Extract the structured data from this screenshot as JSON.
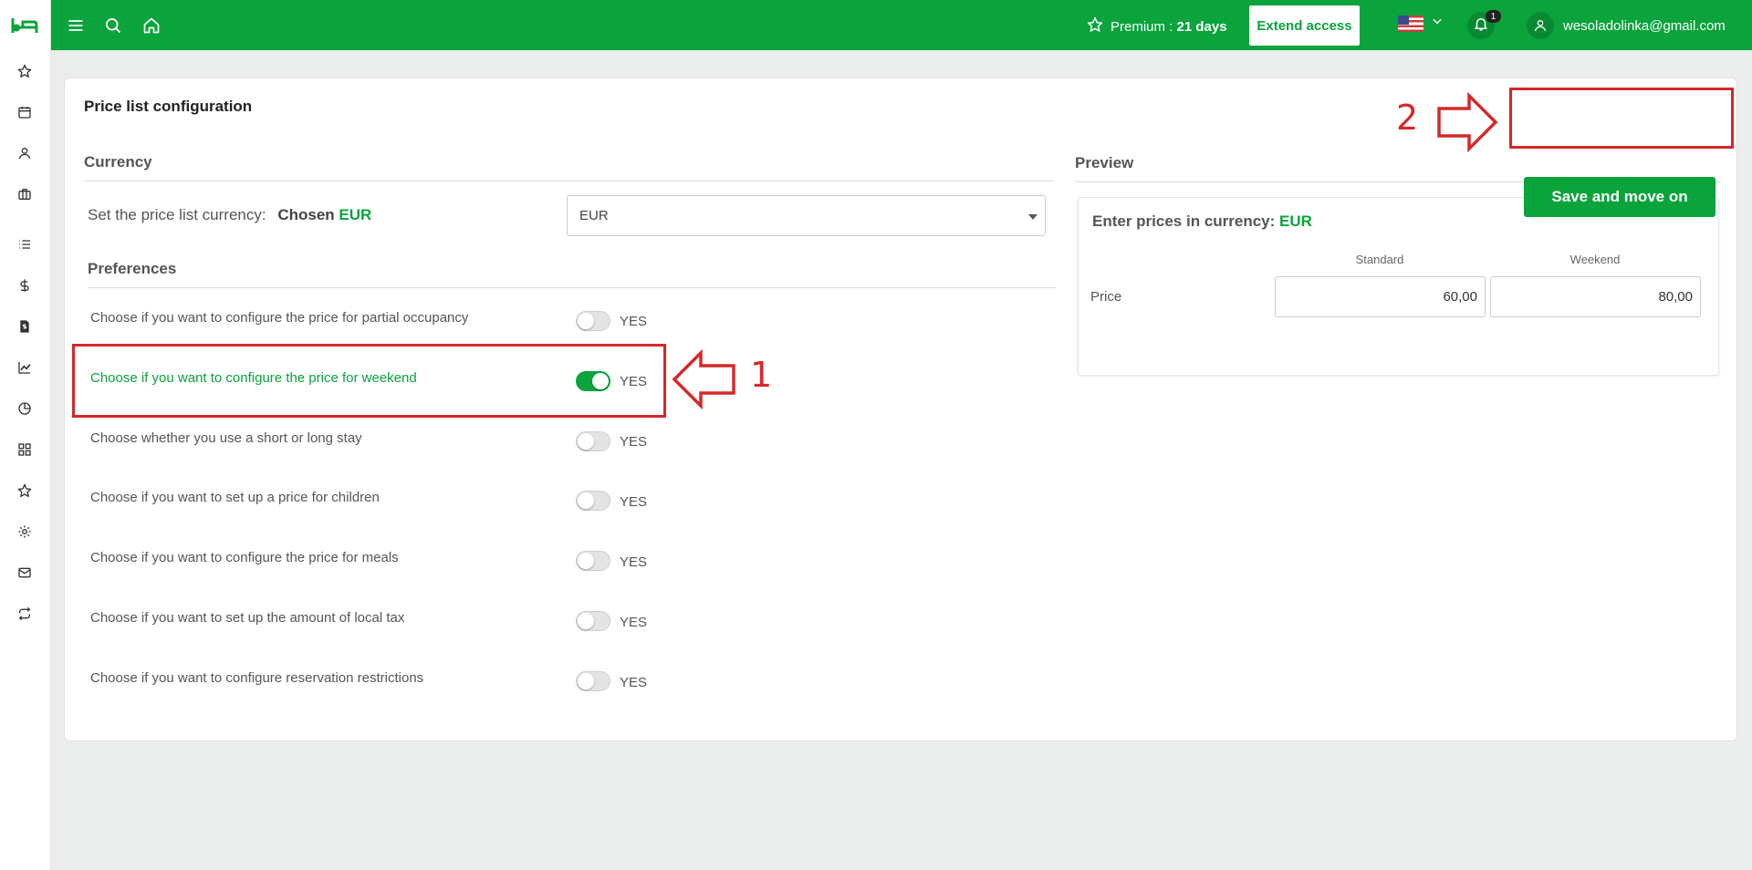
{
  "sidebar": {
    "logo": "bed-icon",
    "items": [
      {
        "icon": "star-icon"
      },
      {
        "icon": "calendar-icon"
      },
      {
        "icon": "user-icon"
      },
      {
        "icon": "briefcase-icon"
      },
      {
        "icon": "list-icon"
      },
      {
        "icon": "dollar-icon"
      },
      {
        "icon": "invoice-icon"
      },
      {
        "icon": "chart-line-icon"
      },
      {
        "icon": "pie-chart-icon"
      },
      {
        "icon": "grid-icon"
      },
      {
        "icon": "star-outline-icon"
      },
      {
        "icon": "gear-icon"
      },
      {
        "icon": "mail-icon"
      },
      {
        "icon": "sync-icon"
      }
    ]
  },
  "topbar": {
    "premium_label": "Premium :",
    "premium_days": "21 days",
    "extend_label": "Extend access",
    "notifications_count": "1",
    "user_email": "wesoladolinka@gmail.com",
    "colors": {
      "brand": "#0aa33c"
    }
  },
  "page": {
    "title": "Price list configuration",
    "save_label": "Save and move on"
  },
  "currency": {
    "heading": "Currency",
    "label": "Set the price list currency:",
    "chosen_label": "Chosen",
    "chosen_value": "EUR",
    "select_value": "EUR"
  },
  "preferences": {
    "heading": "Preferences",
    "toggle_label": "YES",
    "rows": [
      {
        "label": "Choose if you want to configure the price for partial occupancy",
        "on": false
      },
      {
        "label": "Choose if you want to configure the price for weekend",
        "on": true
      },
      {
        "label": "Choose whether you use a short or long stay",
        "on": false
      },
      {
        "label": "Choose if you want to set up a price for children",
        "on": false
      },
      {
        "label": "Choose if you want to configure the price for meals",
        "on": false
      },
      {
        "label": "Choose if you want to set up the amount of local tax",
        "on": false
      },
      {
        "label": "Choose if you want to configure reservation restrictions",
        "on": false
      }
    ]
  },
  "preview": {
    "heading": "Preview",
    "enter_label": "Enter prices in currency:",
    "currency": "EUR",
    "col_standard": "Standard",
    "col_weekend": "Weekend",
    "row_label": "Price",
    "standard_value": "60,00",
    "weekend_value": "80,00"
  },
  "annotations": {
    "num1": "1",
    "num2": "2",
    "color": "#d62828"
  }
}
